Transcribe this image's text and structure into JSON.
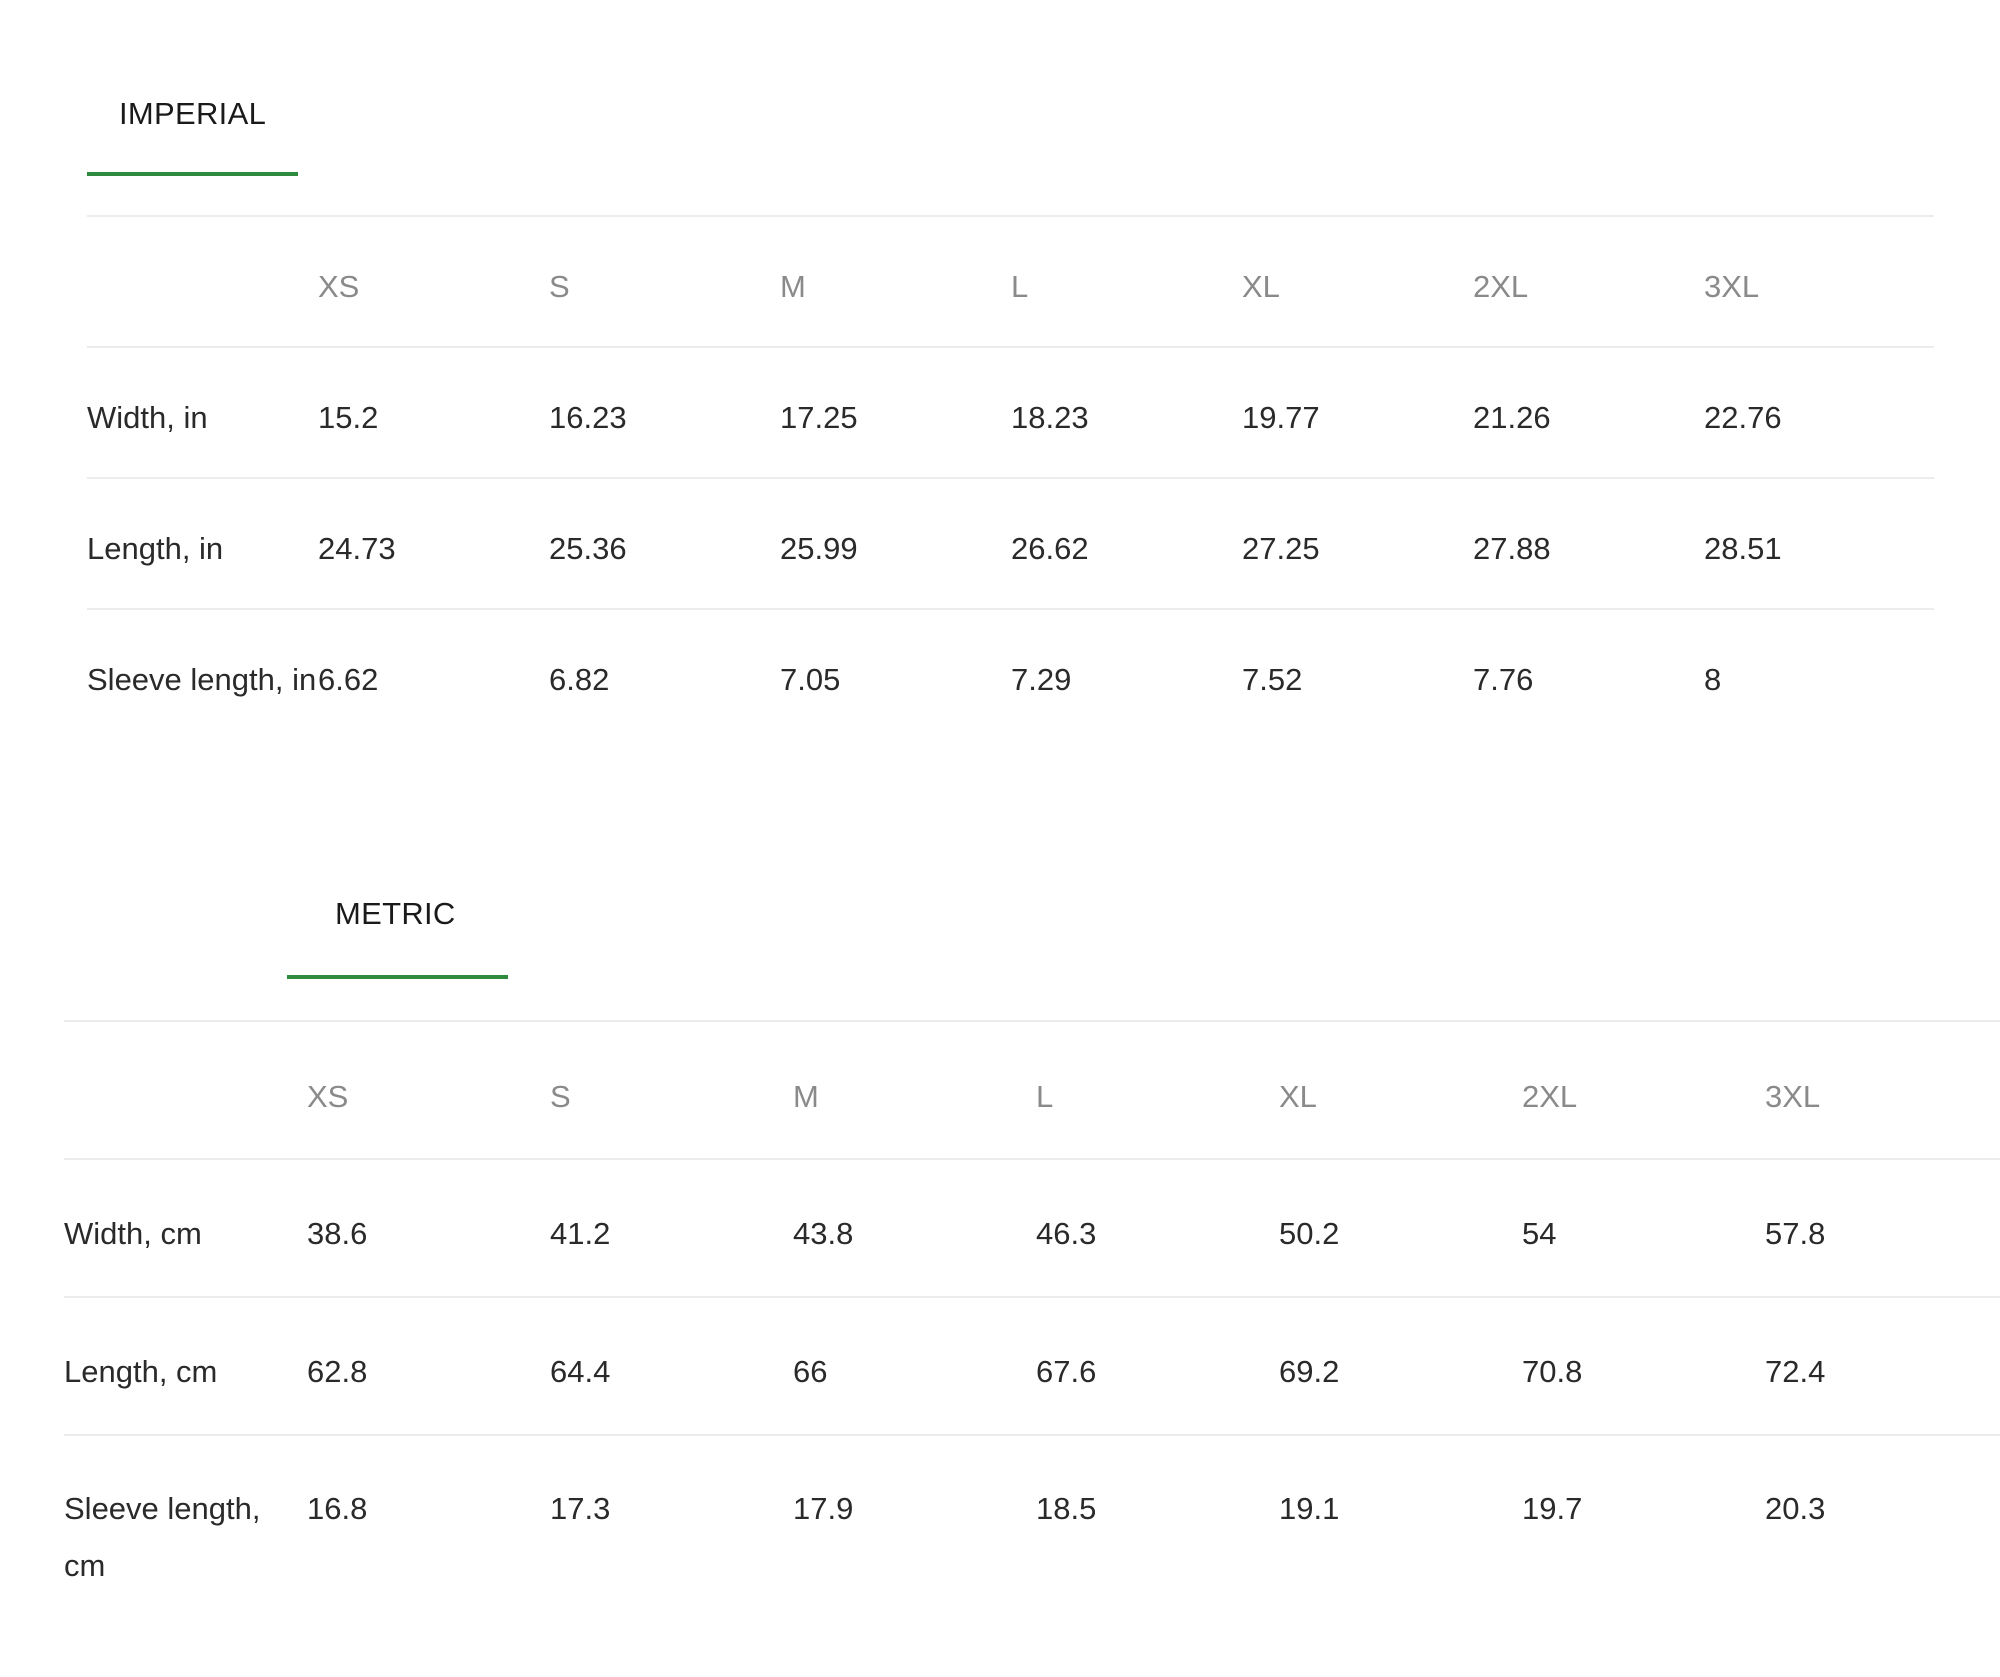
{
  "imperial": {
    "tab_label": "IMPERIAL",
    "sizes": [
      "XS",
      "S",
      "M",
      "L",
      "XL",
      "2XL",
      "3XL"
    ],
    "rows": [
      {
        "label": "Width, in",
        "values": [
          "15.2",
          "16.23",
          "17.25",
          "18.23",
          "19.77",
          "21.26",
          "22.76"
        ]
      },
      {
        "label": "Length, in",
        "values": [
          "24.73",
          "25.36",
          "25.99",
          "26.62",
          "27.25",
          "27.88",
          "28.51"
        ]
      },
      {
        "label": "Sleeve length, in",
        "values": [
          "6.62",
          "6.82",
          "7.05",
          "7.29",
          "7.52",
          "7.76",
          "8"
        ]
      }
    ]
  },
  "metric": {
    "tab_label": "METRIC",
    "sizes": [
      "XS",
      "S",
      "M",
      "L",
      "XL",
      "2XL",
      "3XL"
    ],
    "rows": [
      {
        "label": "Width, cm",
        "values": [
          "38.6",
          "41.2",
          "43.8",
          "46.3",
          "50.2",
          "54",
          "57.8"
        ]
      },
      {
        "label": "Length, cm",
        "values": [
          "62.8",
          "64.4",
          "66",
          "67.6",
          "69.2",
          "70.8",
          "72.4"
        ]
      },
      {
        "label": "Sleeve length, cm",
        "values": [
          "16.8",
          "17.3",
          "17.9",
          "18.5",
          "19.1",
          "19.7",
          "20.3"
        ]
      }
    ]
  },
  "colors": {
    "active_tab_underline": "#2e8b3d",
    "header_text": "#8a8a8a",
    "body_text": "#2a2a2a",
    "divider": "#ececec"
  }
}
